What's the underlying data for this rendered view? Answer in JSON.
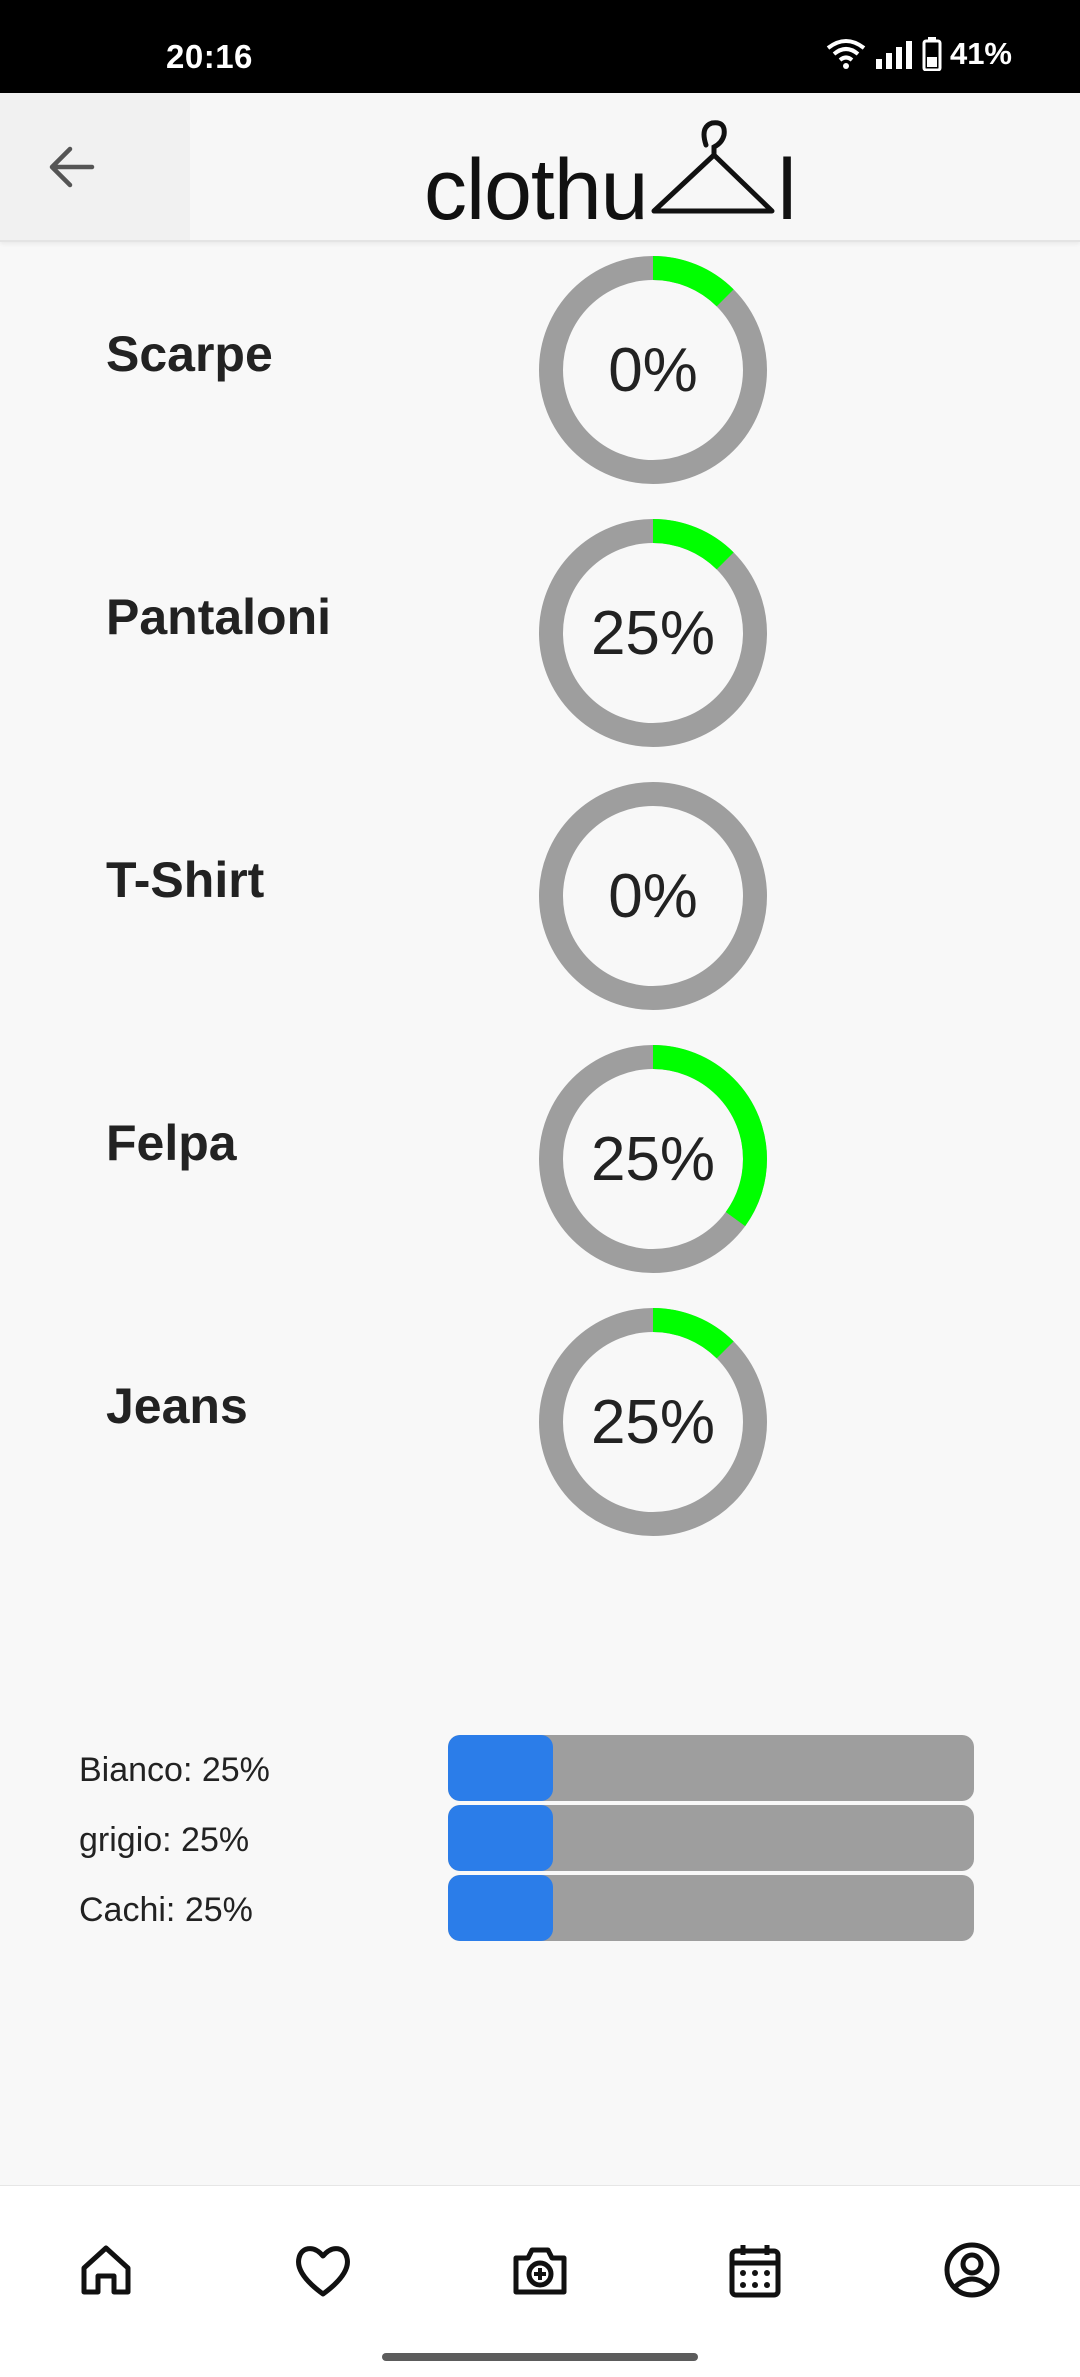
{
  "status_bar": {
    "time": "20:16",
    "battery": "41%"
  },
  "header": {
    "brand": "clothu",
    "brand_suffix": "l",
    "icons": {
      "back": "arrow-left-icon",
      "logo": "hanger-icon"
    }
  },
  "categories": [
    {
      "label": "Scarpe",
      "percent_text": "0%",
      "ring_fill": 0.125
    },
    {
      "label": "Pantaloni",
      "percent_text": "25%",
      "ring_fill": 0.125
    },
    {
      "label": "T-Shirt",
      "percent_text": "0%",
      "ring_fill": 0
    },
    {
      "label": "Felpa",
      "percent_text": "25%",
      "ring_fill": 0.35
    },
    {
      "label": "Jeans",
      "percent_text": "25%",
      "ring_fill": 0.125
    }
  ],
  "colors_stats": [
    {
      "label": "Bianco: 25%",
      "fill": 0.2
    },
    {
      "label": "grigio: 25%",
      "fill": 0.2
    },
    {
      "label": "Cachi: 25%",
      "fill": 0.2
    }
  ],
  "theme": {
    "ring_track": "#9e9e9e",
    "ring_progress": "#00ff00",
    "bar_track": "#9e9e9e",
    "bar_fill": "#2b7de9"
  },
  "bottom_nav": [
    {
      "name": "home-icon"
    },
    {
      "name": "heart-icon"
    },
    {
      "name": "camera-plus-icon"
    },
    {
      "name": "calendar-icon"
    },
    {
      "name": "profile-icon"
    }
  ]
}
